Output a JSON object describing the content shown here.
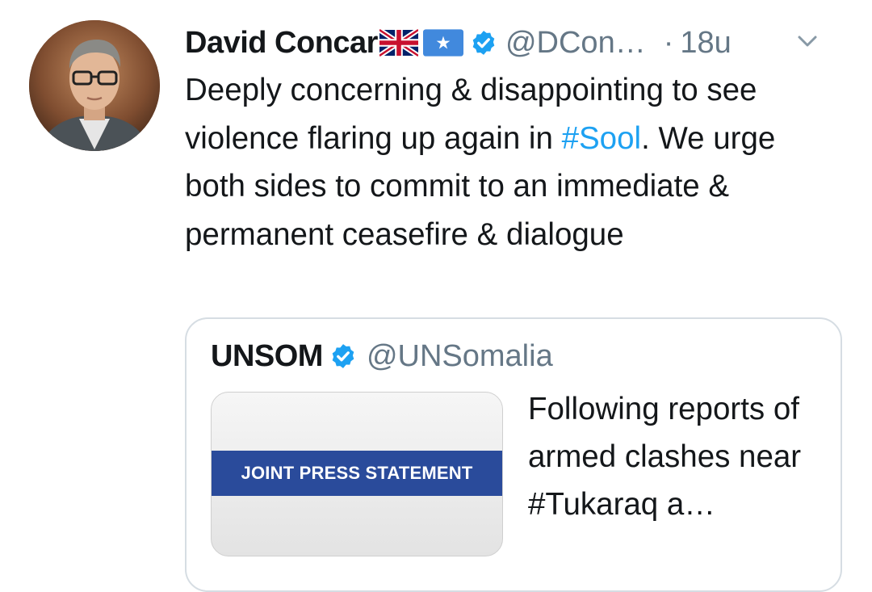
{
  "tweet": {
    "author_name": "David Concar",
    "author_handle": "@DCon…",
    "separator": "·",
    "time": "18u",
    "text_before": "Deeply concerning & disappointing to see violence flaring up again in ",
    "hashtag": "#Sool",
    "text_after": ". We urge both sides to commit to an immediate & permanent ceasefire & dialogue"
  },
  "quoted_tweet": {
    "author_name": "UNSOM",
    "author_handle": "@UNSomalia",
    "image_banner": "JOINT PRESS STATEMENT",
    "text": "Following reports of armed clashes near #Tukaraq a…"
  },
  "icons": {
    "avatar": "avatar-photo",
    "flag_1": "uk-flag-icon",
    "flag_2": "somalia-flag-icon",
    "verified": "verified-badge-icon",
    "menu": "chevron-down-icon"
  },
  "colors": {
    "text_primary": "#14171a",
    "text_secondary": "#657786",
    "link": "#1da1f2",
    "verified": "#1da1f2",
    "banner": "#2a4b9b",
    "border": "#d6dde3"
  }
}
